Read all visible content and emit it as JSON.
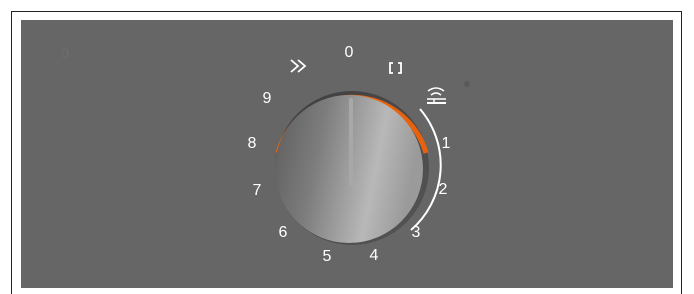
{
  "control": {
    "ghost_marker": "0",
    "positions": [
      "0",
      "1",
      "2",
      "3",
      "4",
      "5",
      "6",
      "7",
      "8",
      "9"
    ],
    "special_icons": [
      "rapid-heat-icon",
      "bridge-zone-icon",
      "keep-warm-icon"
    ],
    "selected_position": "0"
  },
  "colors": {
    "panel": "#666666",
    "active_arc": "#e8620e",
    "label": "#ffffff"
  }
}
